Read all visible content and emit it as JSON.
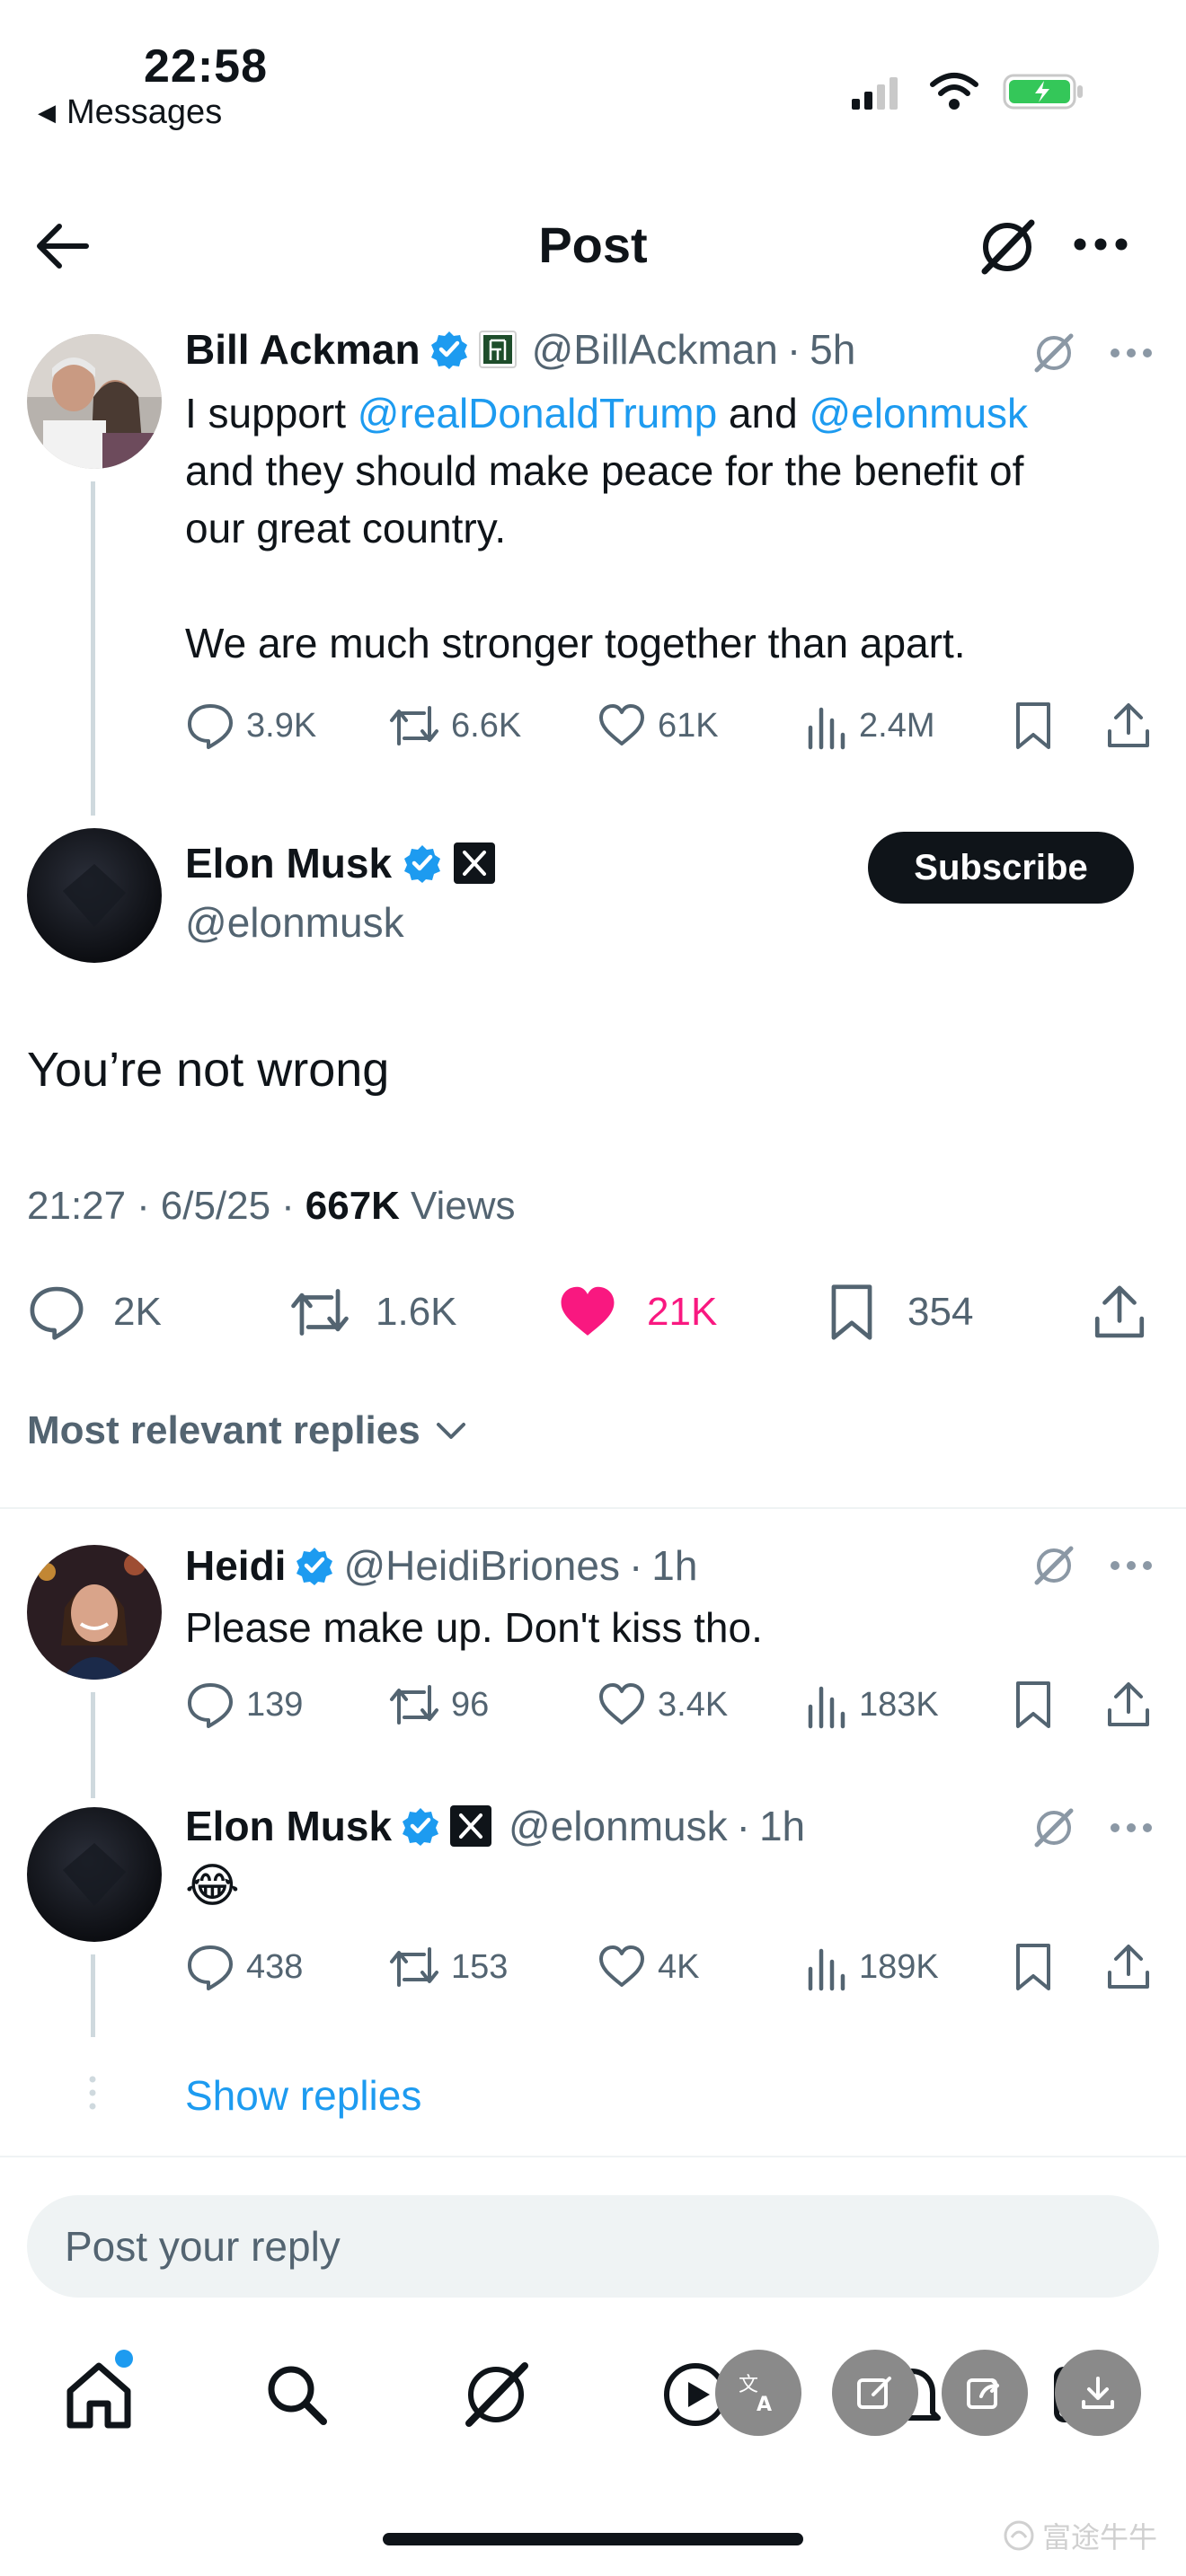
{
  "status_bar": {
    "time": "22:58",
    "back_app": "Messages"
  },
  "header": {
    "title": "Post"
  },
  "parent_post": {
    "author": "Bill Ackman",
    "handle": "@BillAckman",
    "time": "5h",
    "text_pre": "I support ",
    "mention1": "@realDonaldTrump",
    "text_mid": " and ",
    "mention2": "@elonmusk",
    "text_line2": "and they should make peace for the benefit of",
    "text_line3": "our great country.",
    "text_line4": "We are much stronger together than apart.",
    "replies": "3.9K",
    "reposts": "6.6K",
    "likes": "61K",
    "views": "2.4M"
  },
  "main_post": {
    "author": "Elon Musk",
    "handle": "@elonmusk",
    "subscribe_label": "Subscribe",
    "text": "You’re not wrong",
    "time": "21:27",
    "date": "6/5/25",
    "views_count": "667K",
    "views_label": "Views",
    "replies": "2K",
    "reposts": "1.6K",
    "likes": "21K",
    "bookmarks": "354"
  },
  "sort": {
    "label": "Most relevant replies"
  },
  "reply1": {
    "author": "Heidi",
    "handle": "@HeidiBriones",
    "time": "1h",
    "text": "Please make up. Don't kiss tho.",
    "replies": "139",
    "reposts": "96",
    "likes": "3.4K",
    "views": "183K"
  },
  "reply2": {
    "author": "Elon Musk",
    "handle": "@elonmusk",
    "time": "1h",
    "text": "😂",
    "replies": "438",
    "reposts": "153",
    "likes": "4K",
    "views": "189K"
  },
  "show_replies": "Show replies",
  "reply_input": {
    "placeholder": "Post your reply"
  },
  "colors": {
    "accent": "#1d9bf0",
    "like": "#f91880",
    "text": "#0f1419",
    "muted": "#536471"
  },
  "watermark": "富途牛牛"
}
